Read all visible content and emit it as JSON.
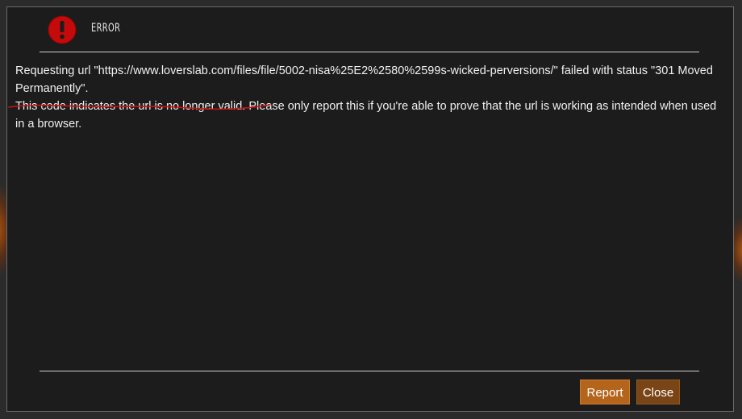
{
  "dialog": {
    "title": "ERROR",
    "icon": "error-exclamation-icon",
    "message": {
      "line1": "Requesting url \"https://www.loverslab.com/files/file/5002-nisa%25E2%2580%2599s-wicked-perversions/\" failed with status \"301 Moved Permanently\".",
      "line2_highlighted": "This code indicates the url is no longer valid.",
      "line2_rest": " Please only report this if you're able to prove that the url is working as intended when used in a browser."
    },
    "buttons": {
      "report_label": "Report",
      "close_label": "Close"
    }
  },
  "colors": {
    "dialog_bg": "#1c1c1c",
    "error_icon": "#c40a0a",
    "annotation_underline": "#d01010",
    "report_button": "#b4651c",
    "close_button": "#7a4516"
  }
}
